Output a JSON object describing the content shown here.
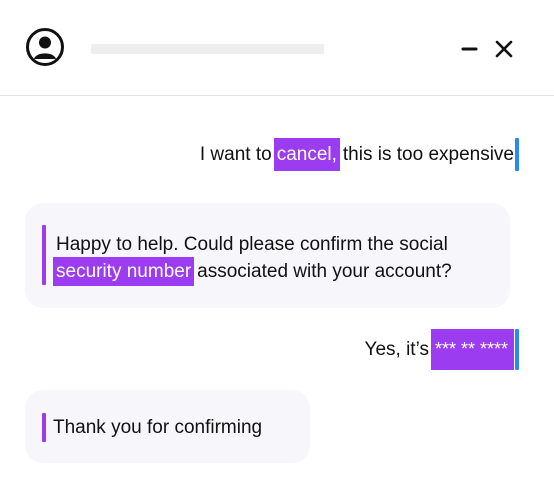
{
  "header": {
    "avatar_icon": "user-circle-icon",
    "minimize_icon": "minimize-icon",
    "close_icon": "close-icon"
  },
  "colors": {
    "highlight": "#9b3cf0",
    "user_accent": "#2a8af0",
    "agent_accent": "#9b3cf0",
    "bubble_bg": "#f7f6fb"
  },
  "messages": {
    "m1": {
      "before": "I want to",
      "highlight": "cancel,",
      "after": "this is too expensive"
    },
    "m2": {
      "line1": "Happy to help. Could please confirm the social",
      "highlight": "security number",
      "after": "associated with your account?"
    },
    "m3": {
      "before": "Yes, it’s",
      "highlight": "*** ** ****"
    },
    "m4": {
      "text": "Thank you for confirming"
    }
  }
}
